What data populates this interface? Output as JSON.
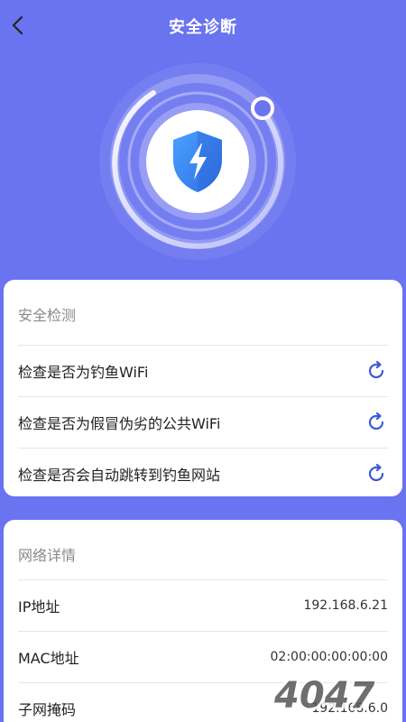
{
  "header": {
    "title": "安全诊断"
  },
  "security": {
    "section_title": "安全检测",
    "items": [
      {
        "label": "检查是否为钓鱼WiFi"
      },
      {
        "label": "检查是否为假冒伪劣的公共WiFi"
      },
      {
        "label": "检查是否会自动跳转到钓鱼网站"
      }
    ]
  },
  "network": {
    "section_title": "网络详情",
    "items": [
      {
        "label": "IP地址",
        "value": "192.168.6.21"
      },
      {
        "label": "MAC地址",
        "value": "02:00:00:00:00:00"
      },
      {
        "label": "子网掩码",
        "value": "192.168.6.0"
      }
    ]
  },
  "watermark": "4047",
  "colors": {
    "background": "#6a73f0",
    "accent": "#3b5bdb",
    "shield": "#3b82f6",
    "card": "#ffffff"
  }
}
